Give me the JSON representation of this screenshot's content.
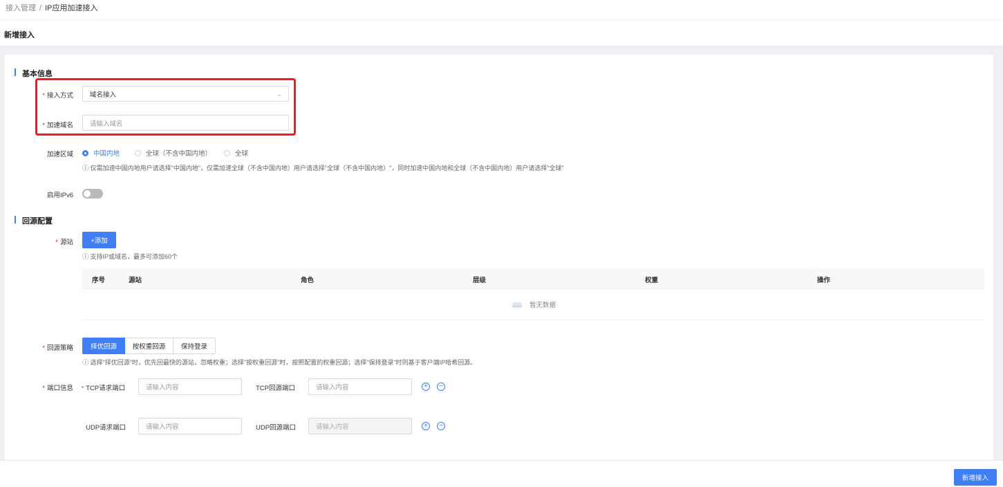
{
  "breadcrumb": {
    "parent": "接入管理",
    "separator": "/",
    "current": "IP应用加速接入"
  },
  "page": {
    "title": "新增接入"
  },
  "basic": {
    "section_title": "基本信息",
    "access_mode": {
      "label": "接入方式",
      "value": "域名接入"
    },
    "domain": {
      "label": "加速域名",
      "placeholder": "请输入域名"
    },
    "region": {
      "label": "加速区域",
      "options": [
        "中国内地",
        "全球（不含中国内地）",
        "全球"
      ],
      "selected": "中国内地",
      "hint": "ⓘ 仅需加速中国内地用户请选择\"中国内地\"，仅需加速全球（不含中国内地）用户请选择\"全球（不含中国内地）\"，同时加速中国内地和全球（不含中国内地）用户请选择\"全球\""
    },
    "ipv6": {
      "label": "启用IPv6",
      "enabled": false
    }
  },
  "origin": {
    "section_title": "回源配置",
    "site": {
      "label": "源站",
      "add_button": "+添加",
      "hint": "ⓘ 支持IP或域名，最多可添加60个"
    },
    "table": {
      "columns": [
        "序号",
        "源站",
        "角色",
        "层级",
        "权重",
        "操作"
      ],
      "empty_text": "暂无数据"
    },
    "strategy": {
      "label": "回源策略",
      "options": [
        "择优回源",
        "按权重回源",
        "保持登录"
      ],
      "selected": "择优回源",
      "hint": "ⓘ 选择\"择优回源\"时，优先回最快的源站，忽略权重；选择\"按权重回源\"时，按照配置的权重回源；选择\"保持登录\"时则基于客户端IP哈希回源。"
    },
    "ports": {
      "label": "端口信息",
      "tcp_req_label": "TCP请求端口",
      "tcp_back_label": "TCP回源端口",
      "udp_req_label": "UDP请求端口",
      "udp_back_label": "UDP回源端口",
      "placeholder": "请输入内容",
      "plus": "+",
      "minus": "−"
    }
  },
  "footer": {
    "submit": "新增接入"
  },
  "colors": {
    "accent": "#3f7ef5",
    "required": "#e1251b",
    "highlight_box": "#ef1c1c"
  }
}
